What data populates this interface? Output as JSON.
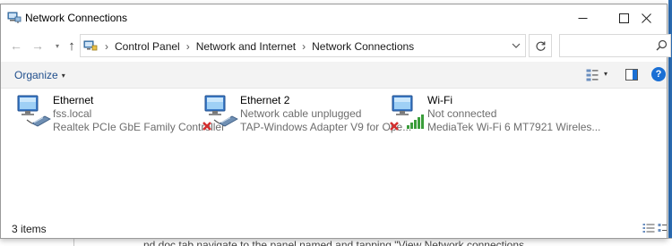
{
  "window": {
    "title": "Network Connections",
    "controls": {
      "minimize": "—",
      "maximize": "☐",
      "close": "✕"
    }
  },
  "nav": {
    "back": "←",
    "forward": "→",
    "recent": "▾",
    "up": "↑",
    "breadcrumbs": [
      "Control Panel",
      "Network and Internet",
      "Network Connections"
    ],
    "dropdown": "⌄",
    "refresh": "↻",
    "search_placeholder": ""
  },
  "toolbar": {
    "organize_label": "Organize",
    "organize_caret": "▾",
    "view_caret": "▾",
    "help_label": "?"
  },
  "connections": [
    {
      "name": "Ethernet",
      "status": "fss.local",
      "device": "Realtek PCIe GbE Family Controller",
      "icon": "ethernet-icon",
      "disconnected": false
    },
    {
      "name": "Ethernet 2",
      "status": "Network cable unplugged",
      "device": "TAP-Windows Adapter V9 for Ope...",
      "icon": "ethernet-icon",
      "disconnected": true
    },
    {
      "name": "Wi-Fi",
      "status": "Not connected",
      "device": "MediaTek Wi-Fi 6 MT7921 Wireles...",
      "icon": "wifi-icon",
      "disconnected": true
    }
  ],
  "statusbar": {
    "item_count": "3 items"
  },
  "background": {
    "snippet": "...nd doc tab navigate to the panel named and tapping \"View Network connections"
  },
  "colors": {
    "accent": "#1a6fd4",
    "link": "#1f4e8c",
    "error_x": "#d32f2f",
    "signal": "#3a9d3a"
  }
}
